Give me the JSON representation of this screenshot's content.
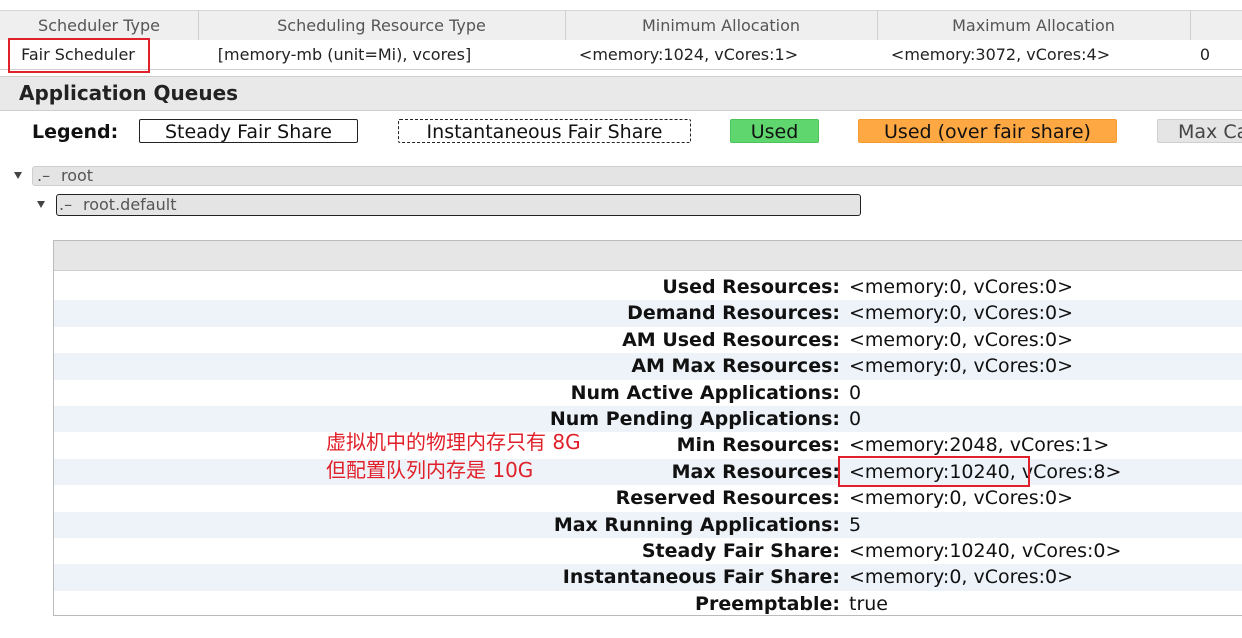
{
  "scheduler": {
    "headers": [
      "Scheduler Type",
      "Scheduling Resource Type",
      "Minimum Allocation",
      "Maximum Allocation"
    ],
    "row": [
      "Fair Scheduler",
      "[memory-mb (unit=Mi), vcores]",
      "<memory:1024, vCores:1>",
      "<memory:3072, vCores:4>",
      "0"
    ]
  },
  "queues": {
    "title": "Application Queues",
    "legend_label": "Legend:",
    "legend": {
      "steady": "Steady Fair Share",
      "instantaneous": "Instantaneous Fair Share",
      "used": "Used",
      "over": "Used (over fair share)",
      "max": "Max Ca"
    },
    "colors": {
      "used": "#5fd66e",
      "over": "#fea843",
      "highlight": "#e0202a"
    }
  },
  "tree": {
    "root_label": "root",
    "default_label": "root.default",
    "marker": ".–"
  },
  "details": [
    {
      "key": "Used Resources:",
      "value": "<memory:0, vCores:0>"
    },
    {
      "key": "Demand Resources:",
      "value": "<memory:0, vCores:0>"
    },
    {
      "key": "AM Used Resources:",
      "value": "<memory:0, vCores:0>"
    },
    {
      "key": "AM Max Resources:",
      "value": "<memory:0, vCores:0>"
    },
    {
      "key": "Num Active Applications:",
      "value": "0"
    },
    {
      "key": "Num Pending Applications:",
      "value": "0"
    },
    {
      "key": "Min Resources:",
      "value": "<memory:2048, vCores:1>"
    },
    {
      "key": "Max Resources:",
      "value": "<memory:10240, vCores:8>"
    },
    {
      "key": "Reserved Resources:",
      "value": "<memory:0, vCores:0>"
    },
    {
      "key": "Max Running Applications:",
      "value": "5"
    },
    {
      "key": "Steady Fair Share:",
      "value": "<memory:10240, vCores:0>"
    },
    {
      "key": "Instantaneous Fair Share:",
      "value": "<memory:0, vCores:0>"
    },
    {
      "key": "Preemptable:",
      "value": "true"
    }
  ],
  "annotation": {
    "line1": "虚拟机中的物理内存只有 8G",
    "line2": "但配置队列内存是 10G"
  }
}
